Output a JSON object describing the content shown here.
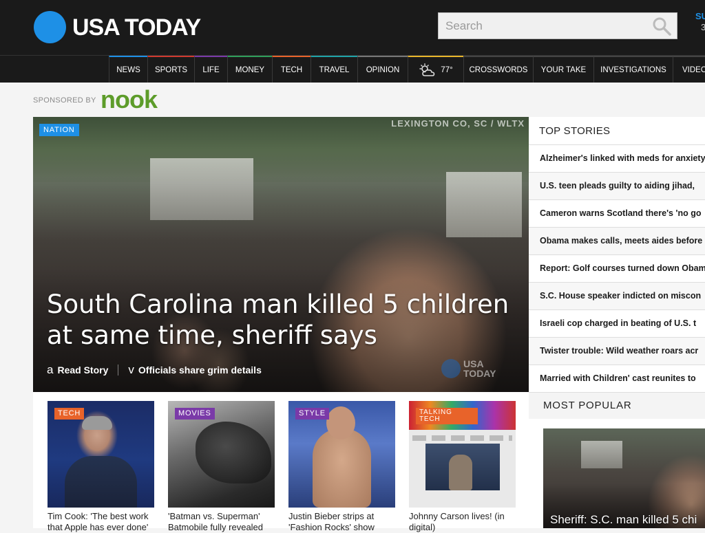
{
  "header": {
    "logo_text": "USA TODAY",
    "search_placeholder": "Search",
    "user_truncated_1": "SU",
    "user_truncated_2": "3"
  },
  "nav": {
    "items": [
      {
        "label": "NEWS",
        "accent": "#1e90e6"
      },
      {
        "label": "SPORTS",
        "accent": "#d03a2f"
      },
      {
        "label": "LIFE",
        "accent": "#7a3aa8"
      },
      {
        "label": "MONEY",
        "accent": "#2f9e5a"
      },
      {
        "label": "TECH",
        "accent": "#e8632a"
      },
      {
        "label": "TRAVEL",
        "accent": "#1fa3a8"
      },
      {
        "label": "OPINION",
        "accent": "#777777"
      },
      {
        "label": "77°",
        "accent": "#e8b52a",
        "icon": "partly-cloudy-icon"
      },
      {
        "label": "CROSSWORDS",
        "accent": "#444444"
      },
      {
        "label": "YOUR TAKE",
        "accent": "#444444"
      },
      {
        "label": "INVESTIGATIONS",
        "accent": "#444444"
      },
      {
        "label": "VIDEO",
        "accent": "#444444"
      }
    ]
  },
  "sponsor": {
    "label": "SPONSORED BY",
    "brand": "nook"
  },
  "hero": {
    "badge": "NATION",
    "badge_color": "#1e90e6",
    "watermark": "LEXINGTON CO, SC / WLTX",
    "headline": "South Carolina man killed 5 children at same time, sheriff says",
    "read_story_icon": "a",
    "read_story_label": "Read Story",
    "video_icon": "v",
    "video_label": "Officials share grim details",
    "logo_watermark": "USA TODAY"
  },
  "thumbs": [
    {
      "badge": "TECH",
      "badge_color": "#e8632a",
      "caption": "Tim Cook: 'The best work that Apple has ever done'"
    },
    {
      "badge": "MOVIES",
      "badge_color": "#7a3aa8",
      "caption": "'Batman vs. Superman' Batmobile fully revealed"
    },
    {
      "badge": "STYLE",
      "badge_color": "#7a3aa8",
      "caption": "Justin Bieber strips at 'Fashion Rocks' show"
    },
    {
      "badge": "TALKING TECH",
      "badge_color": "#e8632a",
      "caption": "Johnny Carson lives! (in digital)"
    }
  ],
  "top_stories": {
    "title": "TOP STORIES",
    "items": [
      "Alzheimer's linked with meds for anxiety",
      "U.S. teen pleads guilty to aiding jihad,",
      "Cameron warns Scotland there's 'no go",
      "Obama makes calls, meets aides before",
      "Report: Golf courses turned down Obama",
      "S.C. House speaker indicted on miscon",
      "Israeli cop charged in beating of U.S. t",
      "Twister trouble: Wild weather roars acr",
      "Married with Children' cast reunites to"
    ]
  },
  "most_popular": {
    "title": "MOST POPULAR",
    "card_caption": "Sheriff: S.C. man killed 5 chi"
  }
}
